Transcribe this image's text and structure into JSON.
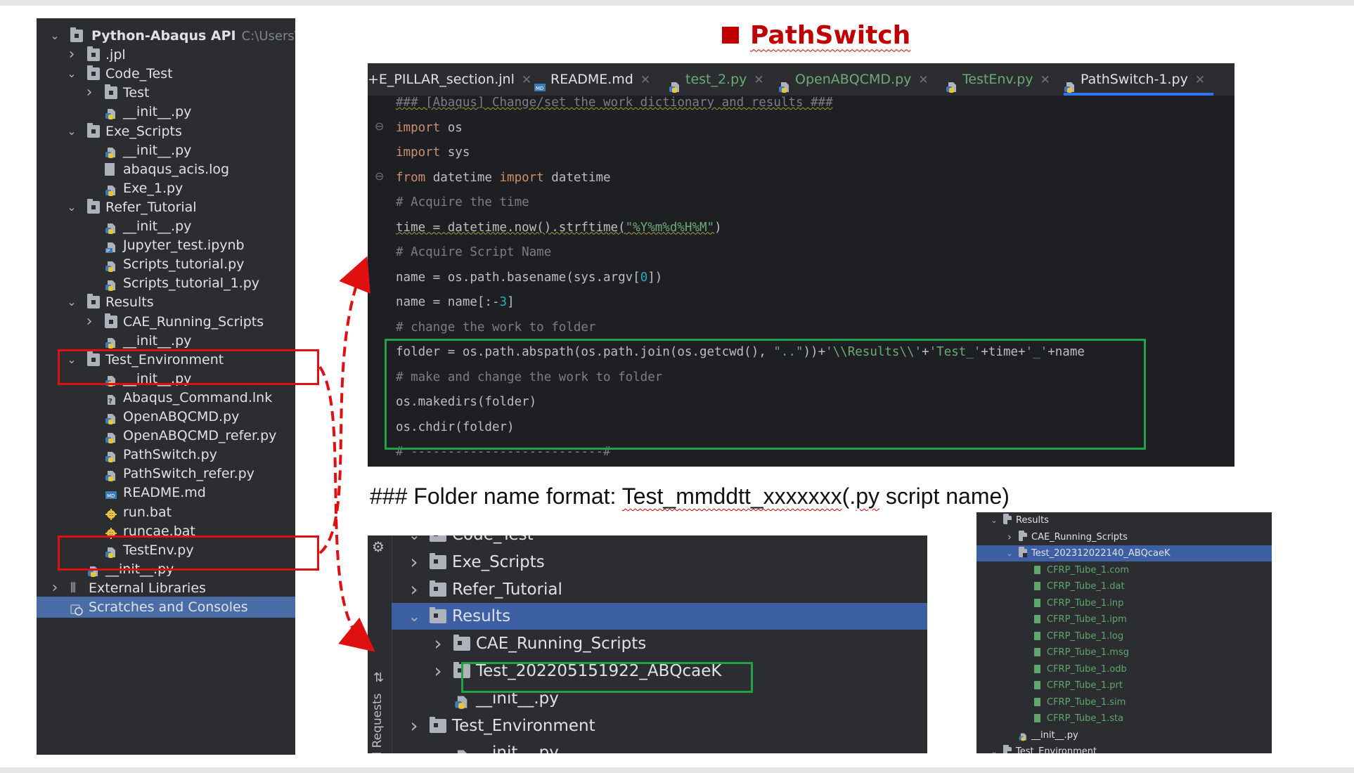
{
  "title": "PathSwitch",
  "project_tree": {
    "root_name": "Python-Abaqus API",
    "root_path": "C:\\Users\\jia",
    "items": [
      {
        "label": ".jpl",
        "depth": 1,
        "kind": "folder",
        "chevron": "right"
      },
      {
        "label": "Code_Test",
        "depth": 1,
        "kind": "folder",
        "chevron": "down"
      },
      {
        "label": "Test",
        "depth": 2,
        "kind": "folder",
        "chevron": "right"
      },
      {
        "label": "__init__.py",
        "depth": 2,
        "kind": "py"
      },
      {
        "label": "Exe_Scripts",
        "depth": 1,
        "kind": "folder",
        "chevron": "down"
      },
      {
        "label": "__init__.py",
        "depth": 2,
        "kind": "py"
      },
      {
        "label": "abaqus_acis.log",
        "depth": 2,
        "kind": "file"
      },
      {
        "label": "Exe_1.py",
        "depth": 2,
        "kind": "py"
      },
      {
        "label": "Refer_Tutorial",
        "depth": 1,
        "kind": "folder",
        "chevron": "down"
      },
      {
        "label": "__init__.py",
        "depth": 2,
        "kind": "py"
      },
      {
        "label": "Jupyter_test.ipynb",
        "depth": 2,
        "kind": "ipynb"
      },
      {
        "label": "Scripts_tutorial.py",
        "depth": 2,
        "kind": "py"
      },
      {
        "label": "Scripts_tutorial_1.py",
        "depth": 2,
        "kind": "py"
      },
      {
        "label": "Results",
        "depth": 1,
        "kind": "folder",
        "chevron": "down"
      },
      {
        "label": "CAE_Running_Scripts",
        "depth": 2,
        "kind": "folder",
        "chevron": "right"
      },
      {
        "label": "__init__.py",
        "depth": 2,
        "kind": "py"
      },
      {
        "label": "Test_Environment",
        "depth": 1,
        "kind": "folder",
        "chevron": "down"
      },
      {
        "label": "__init__.py",
        "depth": 2,
        "kind": "py"
      },
      {
        "label": "Abaqus_Command.lnk",
        "depth": 2,
        "kind": "lnk"
      },
      {
        "label": "OpenABQCMD.py",
        "depth": 2,
        "kind": "py"
      },
      {
        "label": "OpenABQCMD_refer.py",
        "depth": 2,
        "kind": "py"
      },
      {
        "label": "PathSwitch.py",
        "depth": 2,
        "kind": "py"
      },
      {
        "label": "PathSwitch_refer.py",
        "depth": 2,
        "kind": "py"
      },
      {
        "label": "README.md",
        "depth": 2,
        "kind": "md"
      },
      {
        "label": "run.bat",
        "depth": 2,
        "kind": "bat"
      },
      {
        "label": "runcae.bat",
        "depth": 2,
        "kind": "bat"
      },
      {
        "label": "TestEnv.py",
        "depth": 2,
        "kind": "py"
      },
      {
        "label": "__init__.py",
        "depth": 1,
        "kind": "py"
      },
      {
        "label": "External Libraries",
        "depth": 0,
        "kind": "lib",
        "chevron": "right"
      },
      {
        "label": "Scratches and Consoles",
        "depth": 0,
        "kind": "scratch",
        "selected": true
      }
    ]
  },
  "editor": {
    "tabs": [
      {
        "label": "+E_PILLAR_section.jnl",
        "green": false
      },
      {
        "label": "README.md",
        "green": false
      },
      {
        "label": "test_2.py",
        "green": true
      },
      {
        "label": "OpenABQCMD.py",
        "green": true
      },
      {
        "label": "TestEnv.py",
        "green": true
      },
      {
        "label": "PathSwitch-1.py",
        "green": false,
        "active": true
      }
    ],
    "lines": [
      [
        {
          "t": "### [Abaqus] Change/set the work dictionary and results ###",
          "c": "cmt uw"
        }
      ],
      [
        {
          "t": "import",
          "c": "kw"
        },
        {
          "t": " os",
          "c": ""
        }
      ],
      [
        {
          "t": "import",
          "c": "kw"
        },
        {
          "t": " sys",
          "c": ""
        }
      ],
      [
        {
          "t": "from",
          "c": "kw"
        },
        {
          "t": " datetime ",
          "c": ""
        },
        {
          "t": "import",
          "c": "kw"
        },
        {
          "t": " datetime",
          "c": ""
        }
      ],
      [
        {
          "t": "# Acquire the time",
          "c": "cmt"
        }
      ],
      [
        {
          "t": "time = datetime.now().strftime(",
          "c": "uw"
        },
        {
          "t": "\"%Y%m%d%H%M\"",
          "c": "str uw"
        },
        {
          "t": ")",
          "c": ""
        }
      ],
      [
        {
          "t": "# Acquire Script Name",
          "c": "cmt"
        }
      ],
      [
        {
          "t": "name = os.path.basename(sys.argv[",
          "c": ""
        },
        {
          "t": "0",
          "c": "num"
        },
        {
          "t": "])",
          "c": ""
        }
      ],
      [
        {
          "t": "name = name[:-",
          "c": ""
        },
        {
          "t": "3",
          "c": "num"
        },
        {
          "t": "]",
          "c": ""
        }
      ],
      [
        {
          "t": "# change the work to folder",
          "c": "cmt"
        }
      ],
      [
        {
          "t": "folder = os.path.abspath(os.path.join(os.getcwd(), ",
          "c": ""
        },
        {
          "t": "\"..\"",
          "c": "str"
        },
        {
          "t": "))+",
          "c": ""
        },
        {
          "t": "'\\\\Results\\\\'",
          "c": "str"
        },
        {
          "t": "+",
          "c": ""
        },
        {
          "t": "'Test_'",
          "c": "str"
        },
        {
          "t": "+time+",
          "c": ""
        },
        {
          "t": "'_'",
          "c": "str"
        },
        {
          "t": "+name",
          "c": ""
        }
      ],
      [
        {
          "t": "# make and change the work to folder",
          "c": "cmt"
        }
      ],
      [
        {
          "t": "os.makedirs(folder)",
          "c": ""
        }
      ],
      [
        {
          "t": "os.chdir(folder)",
          "c": ""
        }
      ],
      [
        {
          "t": "# --------------------------#",
          "c": "cmt"
        }
      ]
    ]
  },
  "caption": {
    "prefix": "### Folder name format: ",
    "underlined": "Test_mmddtt_xxxxxxx",
    "middle": "(.",
    "underlined2": "py",
    "suffix": " script name)"
  },
  "project_tree_zoom": {
    "side_label": "Pull Requests",
    "items": [
      {
        "label": "Code_Test",
        "indent": 1,
        "chevron": "down"
      },
      {
        "label": "Exe_Scripts",
        "indent": 1,
        "chevron": "right"
      },
      {
        "label": "Refer_Tutorial",
        "indent": 1,
        "chevron": "right"
      },
      {
        "label": "Results",
        "indent": 1,
        "chevron": "down",
        "selected": true
      },
      {
        "label": "CAE_Running_Scripts",
        "indent": 2,
        "chevron": "right"
      },
      {
        "label": "Test_202205151922_ABQcaeK",
        "indent": 2,
        "chevron": "right"
      },
      {
        "label": "__init__.py",
        "indent": 2,
        "kind": "py"
      },
      {
        "label": "Test_Environment",
        "indent": 1,
        "chevron": "right"
      },
      {
        "label": "__init__.py",
        "indent": 2,
        "kind": "py"
      }
    ]
  },
  "results_tree": {
    "items": [
      {
        "label": "Results",
        "indent": 0,
        "chevron": "down",
        "kind": "folder"
      },
      {
        "label": "CAE_Running_Scripts",
        "indent": 1,
        "chevron": "right",
        "kind": "folder"
      },
      {
        "label": "Test_202312022140_ABQcaeK",
        "indent": 1,
        "chevron": "down",
        "kind": "folder",
        "selected": true
      },
      {
        "label": "CFRP_Tube_1.com",
        "indent": 2,
        "kind": "file",
        "green": true
      },
      {
        "label": "CFRP_Tube_1.dat",
        "indent": 2,
        "kind": "file",
        "green": true
      },
      {
        "label": "CFRP_Tube_1.inp",
        "indent": 2,
        "kind": "file",
        "green": true
      },
      {
        "label": "CFRP_Tube_1.ipm",
        "indent": 2,
        "kind": "file",
        "green": true
      },
      {
        "label": "CFRP_Tube_1.log",
        "indent": 2,
        "kind": "file",
        "green": true
      },
      {
        "label": "CFRP_Tube_1.msg",
        "indent": 2,
        "kind": "file",
        "green": true
      },
      {
        "label": "CFRP_Tube_1.odb",
        "indent": 2,
        "kind": "file",
        "green": true
      },
      {
        "label": "CFRP_Tube_1.prt",
        "indent": 2,
        "kind": "file",
        "green": true
      },
      {
        "label": "CFRP_Tube_1.sim",
        "indent": 2,
        "kind": "file",
        "green": true
      },
      {
        "label": "CFRP_Tube_1.sta",
        "indent": 2,
        "kind": "file",
        "green": true
      },
      {
        "label": "__init__.py",
        "indent": 1,
        "kind": "py"
      },
      {
        "label": "Test_Environment",
        "indent": 0,
        "chevron": "down",
        "kind": "folder"
      }
    ]
  },
  "colors": {
    "highlight_red": "#e01010",
    "highlight_green": "#21a249",
    "title_red": "#c00000",
    "ide_bg": "#2b2d30",
    "selection_blue": "#4a6da7"
  }
}
